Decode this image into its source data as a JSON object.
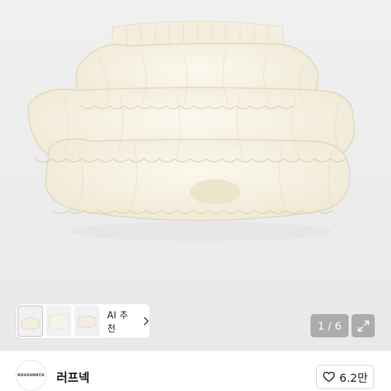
{
  "gallery": {
    "current_page": "1",
    "total_pages": "6",
    "page_counter": "1 / 6",
    "ai_recommend_label": "AI 추천",
    "thumbnails": [
      "thumb-1",
      "thumb-2",
      "thumb-3"
    ],
    "expand_icon": "expand-icon",
    "chevron_icon": "chevron-right-icon"
  },
  "seller": {
    "logo_text": "ROUGHNECK",
    "name": "러프넥"
  },
  "like": {
    "icon": "heart-outline-icon",
    "count": "6.2만"
  },
  "colors": {
    "background": "#ececed",
    "product": "#f6f1e3",
    "overlay": "#78787c"
  }
}
